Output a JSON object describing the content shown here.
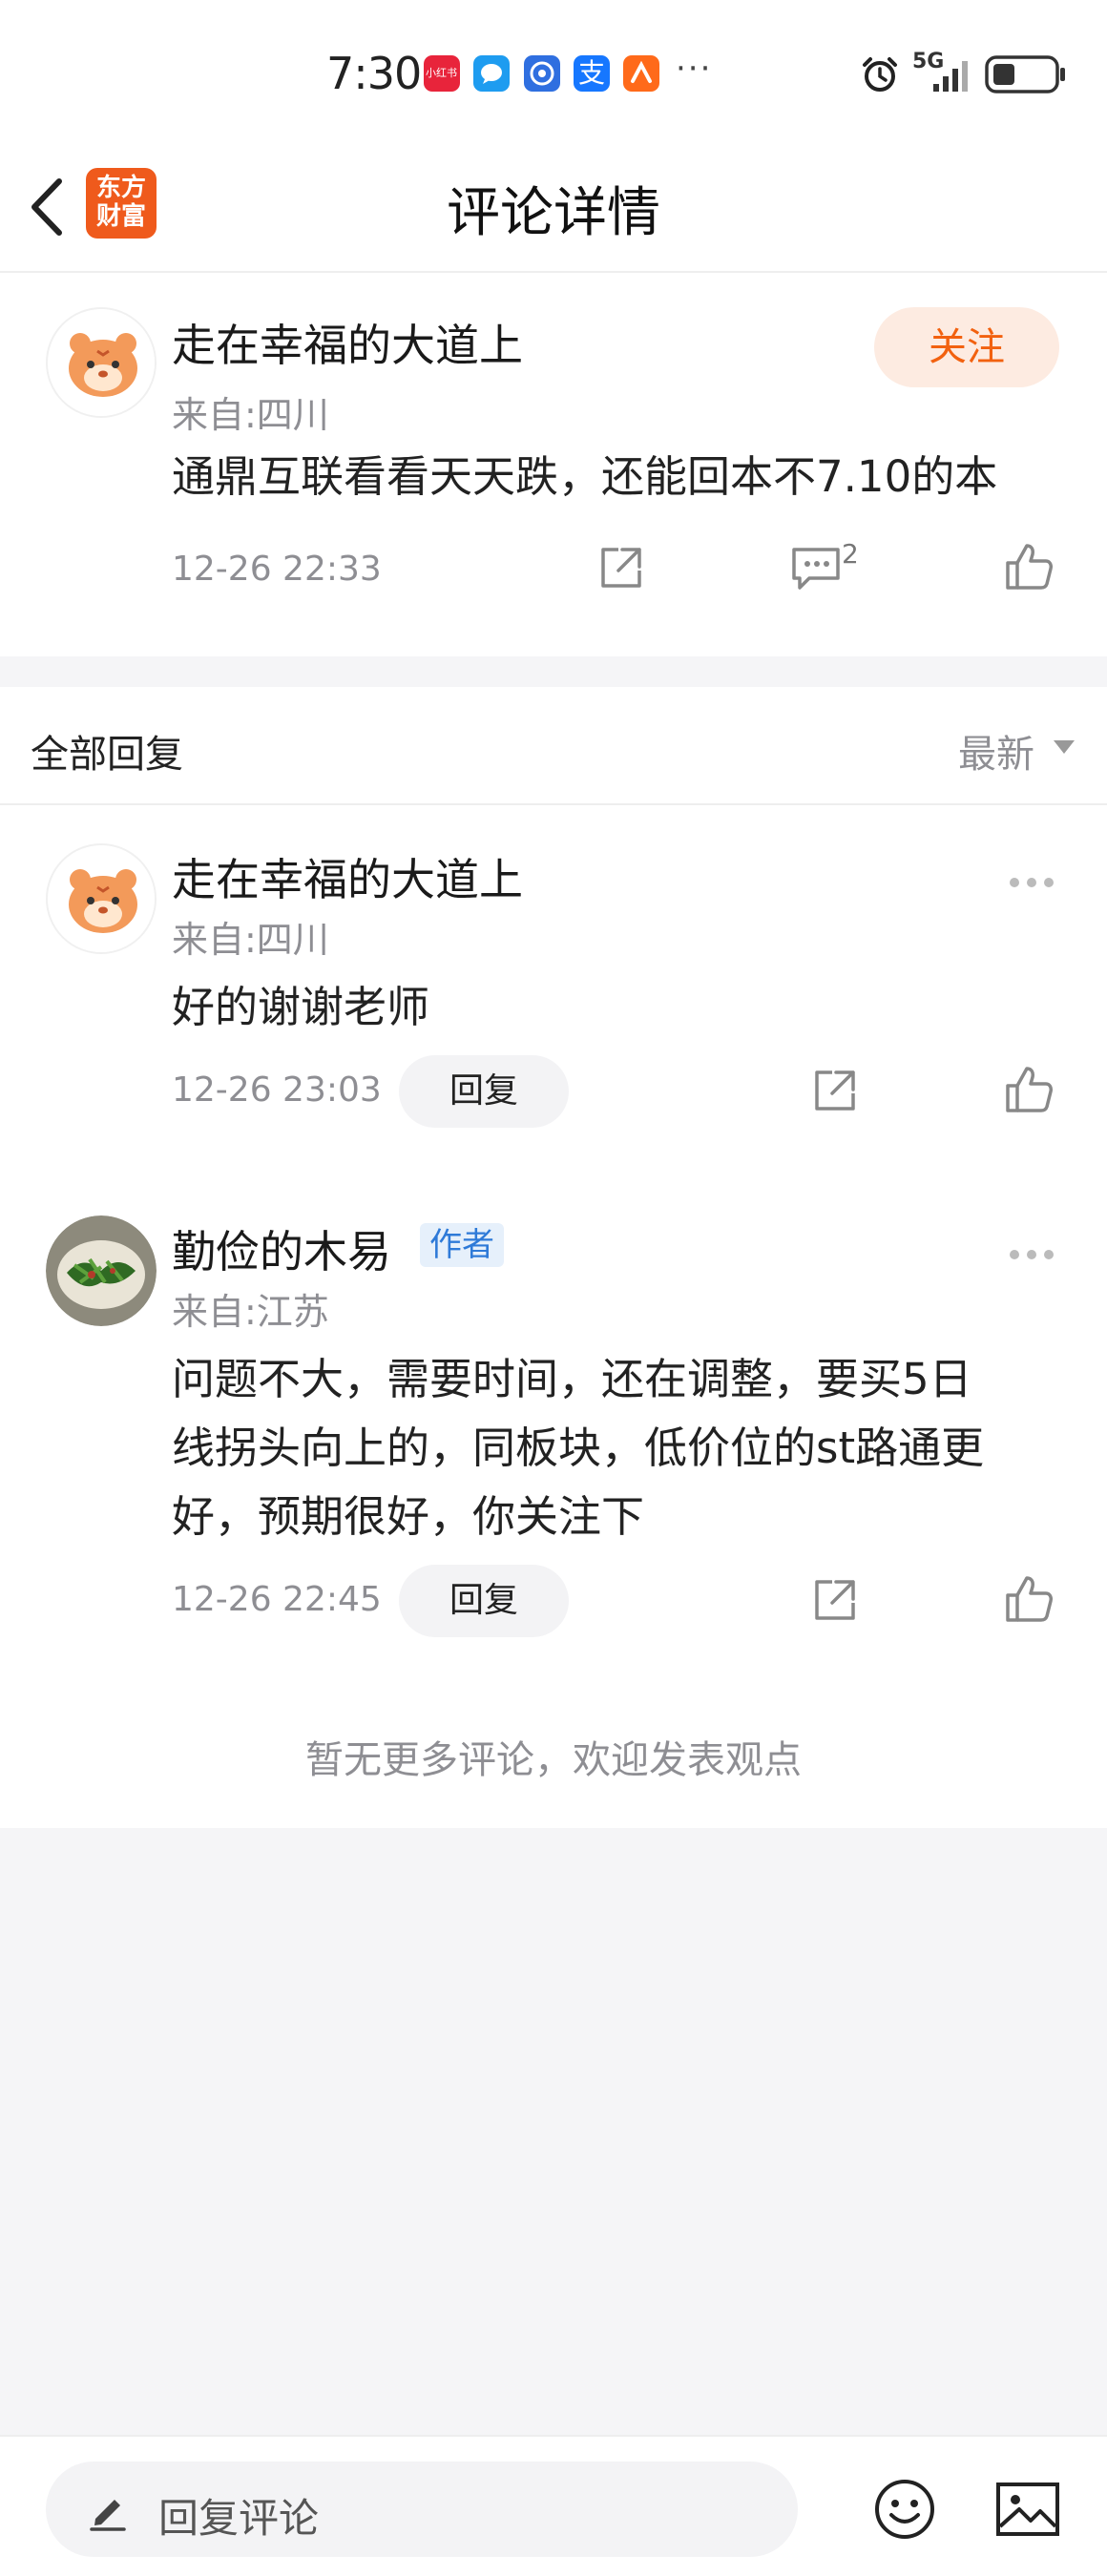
{
  "status_bar": {
    "time": "7:30",
    "overflow": "···",
    "network": "5G",
    "app_icons": [
      {
        "name": "xiaohongshu-app-icon",
        "color": "#e8243b",
        "text": "小红书"
      },
      {
        "name": "chat-app-icon",
        "color": "#1e9cf0",
        "text": ""
      },
      {
        "name": "browser-app-icon",
        "color": "#2f6fe0",
        "text": ""
      },
      {
        "name": "alipay-app-icon",
        "color": "#1677ff",
        "text": "支"
      },
      {
        "name": "taobao-app-icon",
        "color": "#ff6a1a",
        "text": ""
      }
    ]
  },
  "nav": {
    "title": "评论详情",
    "logo_line1": "东方",
    "logo_line2": "财富"
  },
  "main_comment": {
    "username": "走在幸福的大道上",
    "location": "来自:四川",
    "content": "通鼎互联看看天天跌，还能回本不7.10的本",
    "time": "12-26 22:33",
    "follow_label": "关注",
    "comment_count": "2"
  },
  "replies_header": {
    "title": "全部回复",
    "sort": "最新"
  },
  "replies": [
    {
      "username": "走在幸福的大道上",
      "location": "来自:四川",
      "content": "好的谢谢老师",
      "time": "12-26 23:03",
      "reply_label": "回复"
    },
    {
      "username": "勤俭的木易",
      "badge": "作者",
      "location": "来自:江苏",
      "content_lines": [
        "问题不大，需要时间，还在调整，要买5日",
        "线拐头向上的，同板块，低价位的st路通更",
        "好，预期很好，你关注下"
      ],
      "time": "12-26 22:45",
      "reply_label": "回复"
    }
  ],
  "footer_note": "暂无更多评论，欢迎发表观点",
  "bottom_bar": {
    "input_placeholder": "回复评论"
  },
  "colors": {
    "accent": "#f2610f",
    "author_badge": "#2e7ad8",
    "muted": "#8e8e93"
  }
}
